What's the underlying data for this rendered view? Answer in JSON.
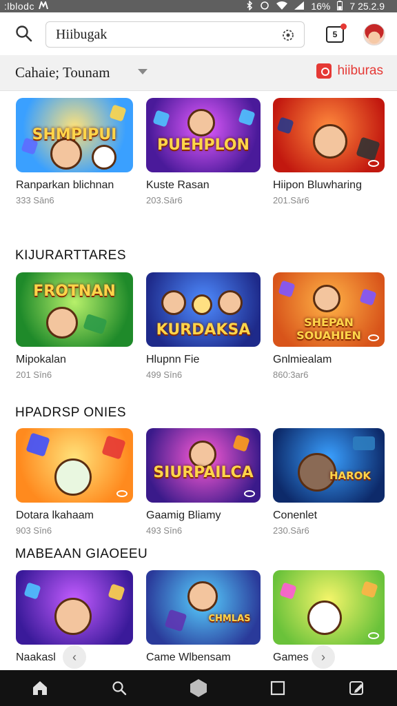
{
  "status_bar": {
    "left_text": ":lblodc",
    "right_text": "7 25.2.9",
    "battery": "16%"
  },
  "search": {
    "value": "Hiibugak"
  },
  "notification_badge": "5",
  "filter": {
    "label": "Cahaie; Tounam",
    "action_label": "hiiburas"
  },
  "rows": [
    {
      "title": "",
      "cards": [
        {
          "name": "Ranparkan blichnan",
          "sub": "333 Sān6",
          "art": "SHMPIPUI"
        },
        {
          "name": "Kuste Rasan",
          "sub": "203.Sār6",
          "art": "PUEHPLON"
        },
        {
          "name": "Hiipon Bluwharing",
          "sub": "201.Sār6",
          "art": ""
        }
      ]
    },
    {
      "title": "KIJURARTTARES",
      "cards": [
        {
          "name": "Mipokalan",
          "sub": "201 Sīn6",
          "art": "FROTNAN"
        },
        {
          "name": "Hlupnn Fie",
          "sub": "499 Sīn6",
          "art": "KURDAKSA"
        },
        {
          "name": "Gnlmiealam",
          "sub": "860:3ar6",
          "art": "SHEPAN SOUAHIEN"
        }
      ]
    },
    {
      "title": "HPADRSP ONIES",
      "cards": [
        {
          "name": "Dotara lkahaam",
          "sub": "903 Sīn6",
          "art": ""
        },
        {
          "name": "Gaamig Bliamy",
          "sub": "493 Sīn6",
          "art": "SIURPAILCA"
        },
        {
          "name": "Conenlet",
          "sub": "230.Sār6",
          "art": "HAROK"
        }
      ]
    },
    {
      "title": "MABEAAN GIAOEEU",
      "cards": [
        {
          "name": "Naakasl",
          "sub": "",
          "art": ""
        },
        {
          "name": "Came Wlbensam",
          "sub": "",
          "art": "CHMLAS"
        },
        {
          "name": "Games",
          "sub": "",
          "art": ""
        }
      ]
    }
  ],
  "colors": {
    "accent": "#e53935",
    "status_bar": "#5f5f5f",
    "bottom_nav": "#121212",
    "filter_bg": "#f1f1f1"
  },
  "icons": {
    "status_left": [
      "carrier-icon"
    ],
    "status_right": [
      "bluetooth-icon",
      "alarm-icon",
      "wifi-icon",
      "signal-icon",
      "battery-icon"
    ],
    "bottom_nav": [
      "home-icon",
      "search-icon",
      "hexagon-icon",
      "square-icon",
      "edit-icon"
    ]
  }
}
